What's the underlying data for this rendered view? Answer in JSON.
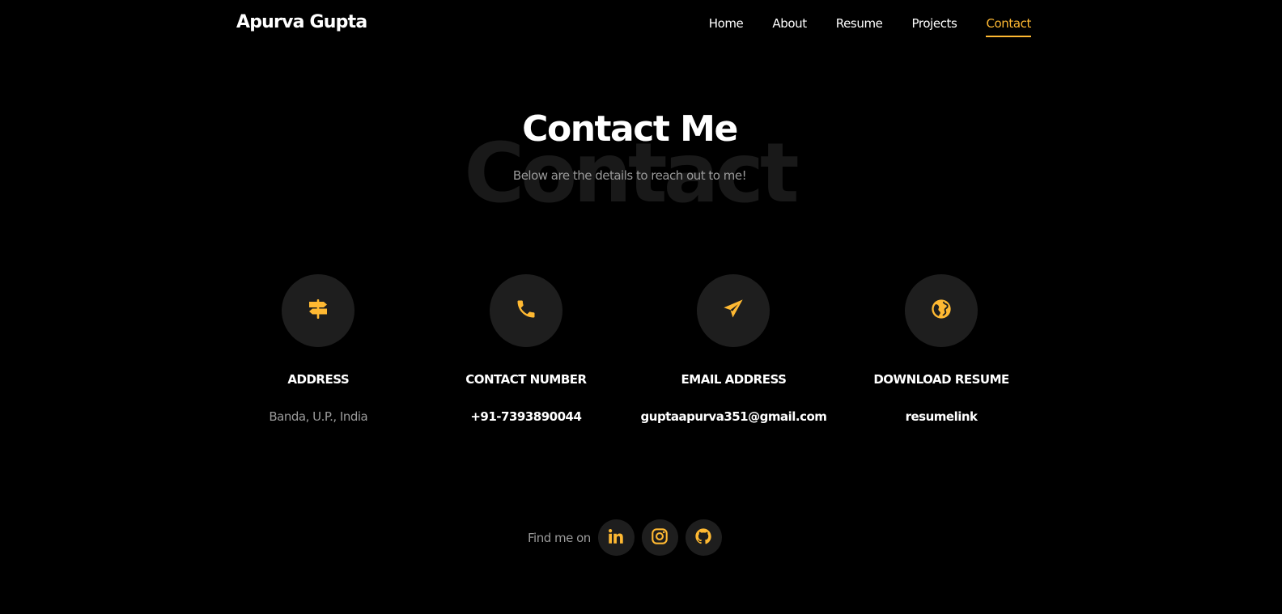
{
  "brand": {
    "name": "Apurva Gupta"
  },
  "nav": {
    "items": [
      {
        "label": "Home"
      },
      {
        "label": "About"
      },
      {
        "label": "Resume"
      },
      {
        "label": "Projects"
      },
      {
        "label": "Contact"
      }
    ],
    "active": "Contact"
  },
  "heading": {
    "background_text": "Contact",
    "title": "Contact Me",
    "subtitle": "Below are the details to reach out to me!"
  },
  "info": [
    {
      "icon": "signpost-icon",
      "title": "ADDRESS",
      "value": "Banda, U.P., India"
    },
    {
      "icon": "phone-icon",
      "title": "CONTACT NUMBER",
      "value": "+91-7393890044"
    },
    {
      "icon": "paper-plane-icon",
      "title": "EMAIL ADDRESS",
      "value": "guptaapurva351@gmail.com"
    },
    {
      "icon": "globe-icon",
      "title": "DOWNLOAD RESUME",
      "value": "resumelink"
    }
  ],
  "social": {
    "label": "Find me on",
    "links": [
      {
        "icon": "linkedin-icon"
      },
      {
        "icon": "instagram-icon"
      },
      {
        "icon": "github-icon"
      }
    ]
  },
  "colors": {
    "background": "#000000",
    "accent": "#ffb932",
    "circle": "#1e1e1e",
    "muted_text": "#9a9a9a"
  }
}
